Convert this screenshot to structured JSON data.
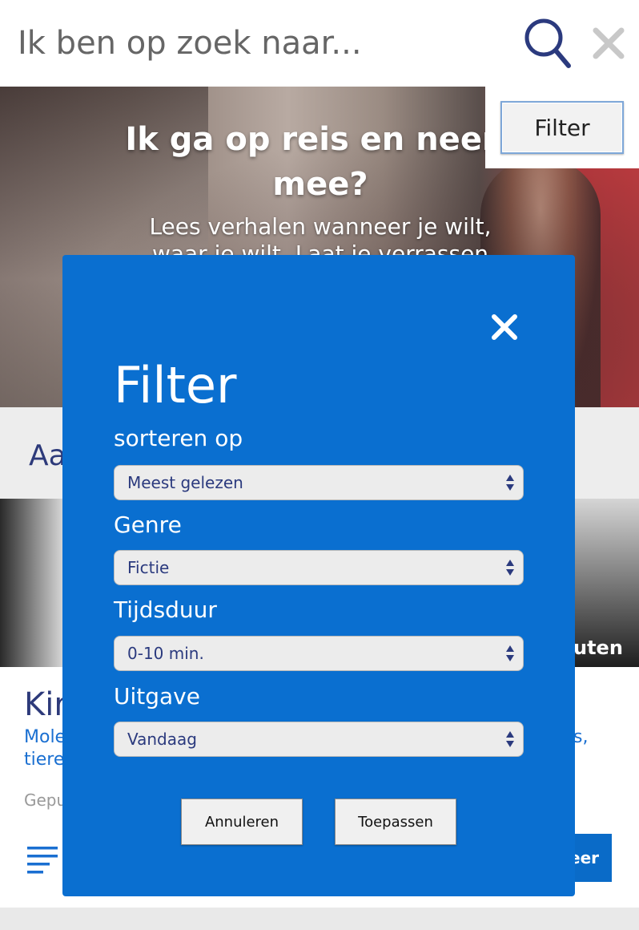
{
  "search": {
    "placeholder": "Ik ben op zoek naar..."
  },
  "hero": {
    "title": "Ik ga op reis en neem mee?",
    "subtitle": "Lees verhalen wanneer je wilt, waar je wilt. Laat je verrassen"
  },
  "filter_button": {
    "label": "Filter"
  },
  "content": {
    "section_heading": "Aa",
    "duration": "uten",
    "article_title": "Kir",
    "article_desc_left": "Mole\ntiere",
    "article_desc_right": "s,",
    "article_meta": "Gepu",
    "more_button": "eer"
  },
  "modal": {
    "title": "Filter",
    "fields": [
      {
        "label": "sorteren op",
        "value": "Meest gelezen"
      },
      {
        "label": "Genre",
        "value": "Fictie"
      },
      {
        "label": "Tijdsduur",
        "value": "0-10 min."
      },
      {
        "label": "Uitgave",
        "value": "Vandaag"
      }
    ],
    "cancel_label": "Annuleren",
    "apply_label": "Toepassen"
  },
  "colors": {
    "modal_bg": "#0a6fd0",
    "title_navy": "#2d3a7a",
    "link_blue": "#1a6fd1"
  }
}
